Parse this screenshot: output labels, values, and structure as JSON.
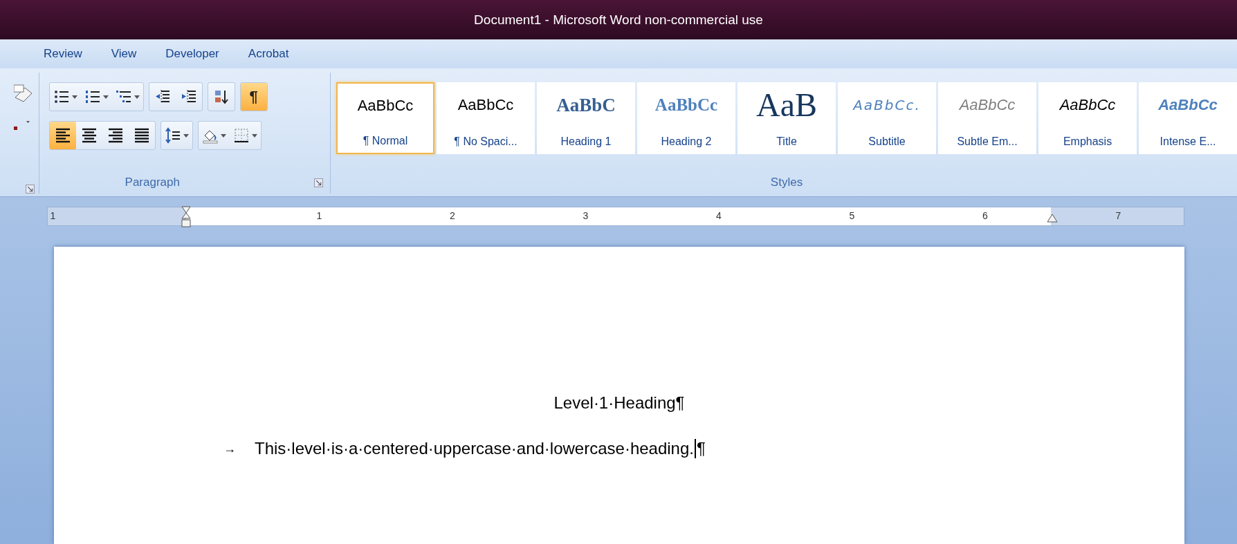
{
  "window": {
    "title": "Document1 - Microsoft Word non-commercial use"
  },
  "tabs": [
    {
      "label": "Review"
    },
    {
      "label": "View"
    },
    {
      "label": "Developer"
    },
    {
      "label": "Acrobat"
    }
  ],
  "ribbon": {
    "paragraph": {
      "title": "Paragraph",
      "row_1": [
        [
          {
            "kind": "bullets",
            "on": false
          },
          {
            "kind": "numbering",
            "on": false
          },
          {
            "kind": "multilevel",
            "on": false
          }
        ],
        [
          {
            "kind": "decrease-indent",
            "on": false
          },
          {
            "kind": "increase-indent",
            "on": false
          }
        ],
        [
          {
            "kind": "sort",
            "on": false
          }
        ],
        [
          {
            "kind": "show-marks",
            "label": "¶",
            "on": true
          }
        ]
      ],
      "row_2": [
        [
          {
            "kind": "align-left",
            "on": true
          },
          {
            "kind": "align-center",
            "on": false
          },
          {
            "kind": "align-right",
            "on": false
          },
          {
            "kind": "justify",
            "on": false
          }
        ],
        [
          {
            "kind": "line-spacing",
            "on": false
          }
        ],
        [
          {
            "kind": "shading",
            "on": false
          },
          {
            "kind": "borders",
            "on": false
          }
        ]
      ]
    },
    "styles": {
      "title": "Styles",
      "items": [
        {
          "kind": "normal",
          "sample": "AaBbCc",
          "label": "¶ Normal",
          "selected": true
        },
        {
          "kind": "no-spacing",
          "sample": "AaBbCc",
          "label": "¶ No Spaci...",
          "selected": false
        },
        {
          "kind": "heading-1",
          "sample": "AaBbC",
          "label": "Heading 1",
          "selected": false
        },
        {
          "kind": "heading-2",
          "sample": "AaBbCc",
          "label": "Heading 2",
          "selected": false
        },
        {
          "kind": "title",
          "sample": "AaB",
          "label": "Title",
          "selected": false
        },
        {
          "kind": "subtitle",
          "sample": "AaBbCc.",
          "label": "Subtitle",
          "selected": false
        },
        {
          "kind": "subtle-emphasis",
          "sample": "AaBbCc",
          "label": "Subtle Em...",
          "selected": false
        },
        {
          "kind": "emphasis",
          "sample": "AaBbCc",
          "label": "Emphasis",
          "selected": false
        },
        {
          "kind": "intense-emphasis",
          "sample": "AaBbCc",
          "label": "Intense E...",
          "selected": false
        }
      ]
    }
  },
  "ruler": {
    "labels": [
      "1",
      "1",
      "2",
      "3",
      "4",
      "5",
      "6",
      "7"
    ]
  },
  "document": {
    "heading": "Level·1·Heading¶",
    "paragraph": {
      "tab_mark": "→",
      "text": "This·level·is·a·centered·uppercase·and·lowercase·heading.",
      "end_mark": "¶"
    }
  }
}
